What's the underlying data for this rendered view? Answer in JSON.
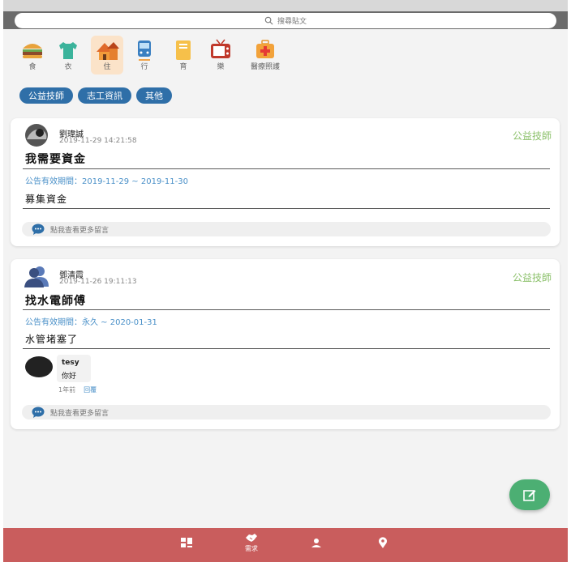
{
  "search": {
    "placeholder": "搜尋貼文"
  },
  "categories": [
    {
      "label": "食",
      "icon": "hamburger-icon"
    },
    {
      "label": "衣",
      "icon": "tshirt-icon"
    },
    {
      "label": "住",
      "icon": "house-icon",
      "active": true
    },
    {
      "label": "行",
      "icon": "train-icon"
    },
    {
      "label": "育",
      "icon": "notebook-icon"
    },
    {
      "label": "樂",
      "icon": "tv-icon"
    },
    {
      "label": "醫療照護",
      "icon": "first-aid-kit-icon"
    }
  ],
  "chips": [
    "公益技師",
    "志工資訊",
    "其他"
  ],
  "posts": [
    {
      "author": "劉瑋誠",
      "time": "2019-11-29 14:21:58",
      "category": "公益技師",
      "title": "我需要資金",
      "period": "公告有效期間：2019-11-29 ~ 2019-11-30",
      "body": "募集資金",
      "more": "點我查看更多留言"
    },
    {
      "author": "鄧清霞",
      "time": "2019-11-26 19:11:13",
      "category": "公益技師",
      "title": "找水電師傅",
      "period": "公告有效期間：永久 ~ 2020-01-31",
      "body": "水管堵塞了",
      "comment": {
        "user": "tesy",
        "text": "你好",
        "age": "1年前",
        "reply": "回覆"
      },
      "more": "點我查看更多留言"
    }
  ],
  "nav": [
    {
      "icon": "dashboard-icon",
      "label": ""
    },
    {
      "icon": "handshake-icon",
      "label": "需求",
      "active": true
    },
    {
      "icon": "person-icon",
      "label": ""
    },
    {
      "icon": "location-pin-icon",
      "label": ""
    }
  ],
  "colors": {
    "accent_blue": "#2f6fa8",
    "category_green": "#8bc06a",
    "link_blue": "#4a90c8",
    "bottom_nav": "#c95d5d",
    "fab_green": "#4caf73",
    "topbar_gray": "#6b6b6b"
  }
}
